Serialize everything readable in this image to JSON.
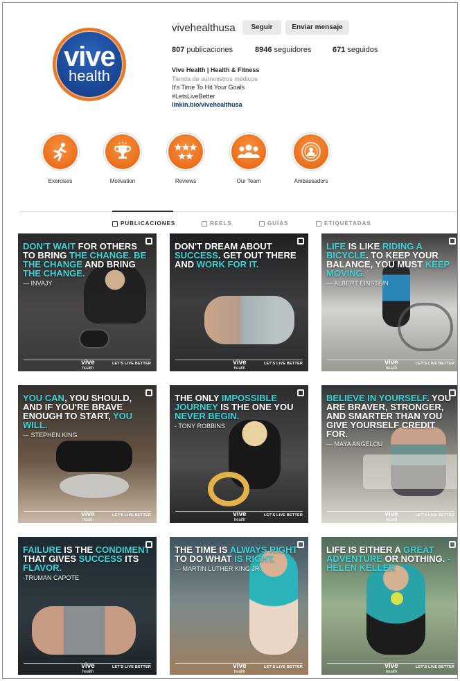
{
  "profile": {
    "logo_line1": "vive",
    "logo_line2": "health",
    "username": "vivehealthusa",
    "follow_label": "Seguir",
    "message_label": "Enviar mensaje",
    "stats": {
      "posts_count": "807",
      "posts_label": "publicaciones",
      "followers_count": "8946",
      "followers_label": "seguidores",
      "following_count": "671",
      "following_label": "seguidos"
    },
    "bio": {
      "name": "Vive Health | Health & Fitness",
      "category": "Tienda de suministros médicos",
      "line1": "It's Time To Hit Your Goals",
      "line2": "#LetsLiveBetter",
      "link": "linkin.bio/vivehealthusa"
    }
  },
  "highlights": [
    {
      "label": "Exercises",
      "icon": "runner-icon"
    },
    {
      "label": "Motivation",
      "icon": "trophy-icon"
    },
    {
      "label": "Reviews",
      "icon": "stars-icon"
    },
    {
      "label": "Our Team",
      "icon": "team-icon"
    },
    {
      "label": "Ambassadors",
      "icon": "ambassador-icon"
    }
  ],
  "tabs": [
    {
      "label": "PUBLICACIONES",
      "icon": "grid-icon",
      "active": true
    },
    {
      "label": "REELS",
      "icon": "reels-icon",
      "active": false
    },
    {
      "label": "GUÍAS",
      "icon": "guides-icon",
      "active": false
    },
    {
      "label": "ETIQUETADAS",
      "icon": "tagged-icon",
      "active": false
    }
  ],
  "posts": [
    {
      "parts": [
        [
          "h",
          "DON'T WAIT "
        ],
        [
          "w",
          "FOR OTHERS TO BRING "
        ],
        [
          "h",
          "THE CHANGE. BE THE CHANGE"
        ],
        [
          "w",
          " AND BRING "
        ],
        [
          "h",
          "THE CHANGE."
        ]
      ],
      "author": "— INVAJY"
    },
    {
      "parts": [
        [
          "w",
          "DON'T DREAM ABOUT "
        ],
        [
          "h",
          "SUCCESS"
        ],
        [
          "w",
          ". GET OUT THERE AND "
        ],
        [
          "h",
          "WORK FOR IT."
        ]
      ],
      "author": ""
    },
    {
      "parts": [
        [
          "h",
          "LIFE "
        ],
        [
          "w",
          "IS LIKE "
        ],
        [
          "h",
          "RIDING A BICYCLE"
        ],
        [
          "w",
          ". TO KEEP YOUR BALANCE, YOU MUST "
        ],
        [
          "h",
          "KEEP MOVING."
        ]
      ],
      "author": "— ALBERT EINSTEIN"
    },
    {
      "parts": [
        [
          "h",
          "YOU CAN"
        ],
        [
          "w",
          ", YOU SHOULD, AND IF YOU'RE BRAVE ENOUGH TO START, "
        ],
        [
          "h",
          "YOU WILL."
        ]
      ],
      "author": "— STEPHEN KING"
    },
    {
      "parts": [
        [
          "w",
          "THE ONLY "
        ],
        [
          "h",
          "IMPOSSIBLE JOURNEY"
        ],
        [
          "w",
          " IS THE ONE YOU "
        ],
        [
          "h",
          "NEVER BEGIN."
        ]
      ],
      "author": "- TONY ROBBINS"
    },
    {
      "parts": [
        [
          "h",
          "BELIEVE IN YOURSELF"
        ],
        [
          "w",
          ". YOU ARE BRAVER, STRONGER, AND SMARTER THAN YOU GIVE YOURSELF CREDIT FOR."
        ]
      ],
      "author": "— MAYA ANGELOU"
    },
    {
      "parts": [
        [
          "h",
          "FAILURE "
        ],
        [
          "w",
          "IS THE "
        ],
        [
          "h",
          "CONDIMENT "
        ],
        [
          "w",
          "THAT GIVES "
        ],
        [
          "h",
          "SUCCESS "
        ],
        [
          "w",
          "ITS "
        ],
        [
          "h",
          "FLAVOR."
        ]
      ],
      "author": "-TRUMAN CAPOTE"
    },
    {
      "parts": [
        [
          "w",
          "THE TIME IS "
        ],
        [
          "h",
          "ALWAYS RIGHT"
        ],
        [
          "w",
          " TO DO WHAT "
        ],
        [
          "h",
          "IS RIGHT."
        ]
      ],
      "author": "— MARTIN LUTHER KING JR."
    },
    {
      "parts": [
        [
          "w",
          "LIFE IS EITHER A "
        ],
        [
          "h",
          "GREAT ADVENTURE"
        ],
        [
          "w",
          " OR NOTHING. "
        ],
        [
          "h",
          "- HELEN KELLER"
        ]
      ],
      "author": ""
    }
  ],
  "post_footer": {
    "logo_line1": "vive",
    "logo_line2": "health",
    "tagline": "LET'S LIVE BETTER"
  },
  "colors": {
    "accent_orange": "#ec6f1d",
    "quote_highlight": "#3fd3d8",
    "logo_blue": "#1b4a9a"
  }
}
